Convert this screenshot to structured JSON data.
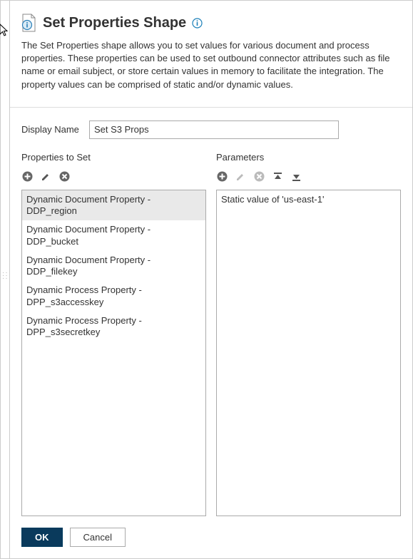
{
  "header": {
    "title": "Set Properties Shape",
    "description": "The Set Properties shape allows you to set values for various document and process properties. These properties can be used to set outbound connector attributes such as file name or email subject, or store certain values in memory to facilitate the integration. The property values can be comprised of static and/or dynamic values."
  },
  "form": {
    "display_name_label": "Display Name",
    "display_name_value": "Set S3 Props"
  },
  "left": {
    "heading": "Properties to Set",
    "items": [
      "Dynamic Document Property - DDP_region",
      "Dynamic Document Property - DDP_bucket",
      "Dynamic Document Property - DDP_filekey",
      "Dynamic Process Property - DPP_s3accesskey",
      "Dynamic Process Property - DPP_s3secretkey"
    ],
    "selected_index": 0
  },
  "right": {
    "heading": "Parameters",
    "items": [
      "Static value of 'us-east-1'"
    ]
  },
  "footer": {
    "ok": "OK",
    "cancel": "Cancel"
  },
  "icons": {
    "page": "page-info-icon",
    "info": "info-icon",
    "add": "add-icon",
    "edit": "edit-icon",
    "delete": "delete-icon",
    "moveup": "move-up-icon",
    "movedown": "move-down-icon"
  }
}
